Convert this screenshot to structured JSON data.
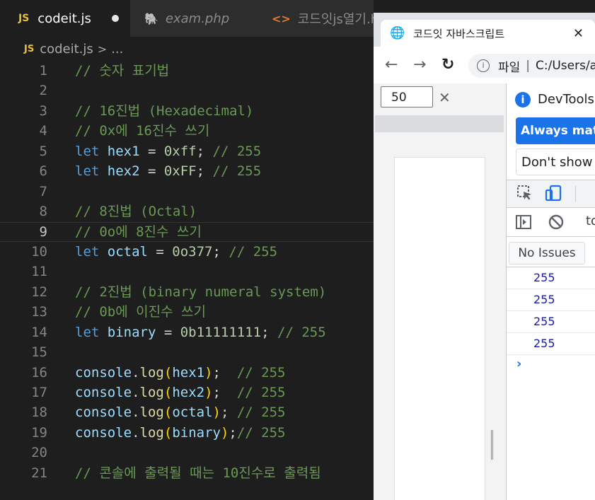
{
  "editor": {
    "tabs": [
      {
        "label": "codeit.js",
        "badge": "JS",
        "active": true,
        "dirty": true
      },
      {
        "label": "exam.php",
        "active": false
      },
      {
        "label": "코드잇js열기.h",
        "active": false
      }
    ],
    "breadcrumb": {
      "badge": "JS",
      "file": "codeit.js",
      "separator": ">",
      "more": "..."
    },
    "current_line": 9,
    "lines": [
      {
        "n": "1",
        "parts": [
          [
            "cm",
            "// 숫자 표기법"
          ]
        ]
      },
      {
        "n": "2",
        "parts": []
      },
      {
        "n": "3",
        "parts": [
          [
            "cm",
            "// 16진법 (Hexadecimal)"
          ]
        ]
      },
      {
        "n": "4",
        "parts": [
          [
            "cm",
            "// 0x에 16진수 쓰기"
          ]
        ]
      },
      {
        "n": "5",
        "parts": [
          [
            "kw",
            "let "
          ],
          [
            "var",
            "hex1"
          ],
          [
            "op",
            " = "
          ],
          [
            "num",
            "0xff"
          ],
          [
            "op",
            "; "
          ],
          [
            "cm",
            "// 255"
          ]
        ]
      },
      {
        "n": "6",
        "parts": [
          [
            "kw",
            "let "
          ],
          [
            "var",
            "hex2"
          ],
          [
            "op",
            " = "
          ],
          [
            "num",
            "0xFF"
          ],
          [
            "op",
            "; "
          ],
          [
            "cm",
            "// 255"
          ]
        ]
      },
      {
        "n": "7",
        "parts": []
      },
      {
        "n": "8",
        "parts": [
          [
            "cm",
            "// 8진법 (Octal)"
          ]
        ]
      },
      {
        "n": "9",
        "parts": [
          [
            "cm",
            "// 0o에 8진수 쓰기"
          ]
        ]
      },
      {
        "n": "10",
        "parts": [
          [
            "kw",
            "let "
          ],
          [
            "var",
            "octal"
          ],
          [
            "op",
            " = "
          ],
          [
            "num",
            "0o377"
          ],
          [
            "op",
            "; "
          ],
          [
            "cm",
            "// 255"
          ]
        ]
      },
      {
        "n": "11",
        "parts": []
      },
      {
        "n": "12",
        "parts": [
          [
            "cm",
            "// 2진법 (binary numeral system)"
          ]
        ]
      },
      {
        "n": "13",
        "parts": [
          [
            "cm",
            "// 0b에 이진수 쓰기"
          ]
        ]
      },
      {
        "n": "14",
        "parts": [
          [
            "kw",
            "let "
          ],
          [
            "var",
            "binary"
          ],
          [
            "op",
            " = "
          ],
          [
            "num",
            "0b11111111"
          ],
          [
            "op",
            "; "
          ],
          [
            "cm",
            "// 255"
          ]
        ]
      },
      {
        "n": "15",
        "parts": []
      },
      {
        "n": "16",
        "parts": [
          [
            "var",
            "console"
          ],
          [
            "op",
            "."
          ],
          [
            "fn",
            "log"
          ],
          [
            "br",
            "("
          ],
          [
            "var",
            "hex1"
          ],
          [
            "br",
            ")"
          ],
          [
            "op",
            ";  "
          ],
          [
            "cm",
            "// 255"
          ]
        ]
      },
      {
        "n": "17",
        "parts": [
          [
            "var",
            "console"
          ],
          [
            "op",
            "."
          ],
          [
            "fn",
            "log"
          ],
          [
            "br",
            "("
          ],
          [
            "var",
            "hex2"
          ],
          [
            "br",
            ")"
          ],
          [
            "op",
            ";  "
          ],
          [
            "cm",
            "// 255"
          ]
        ]
      },
      {
        "n": "18",
        "parts": [
          [
            "var",
            "console"
          ],
          [
            "op",
            "."
          ],
          [
            "fn",
            "log"
          ],
          [
            "br",
            "("
          ],
          [
            "var",
            "octal"
          ],
          [
            "br",
            ")"
          ],
          [
            "op",
            "; "
          ],
          [
            "cm",
            "// 255"
          ]
        ]
      },
      {
        "n": "19",
        "parts": [
          [
            "var",
            "console"
          ],
          [
            "op",
            "."
          ],
          [
            "fn",
            "log"
          ],
          [
            "br",
            "("
          ],
          [
            "var",
            "binary"
          ],
          [
            "br",
            ")"
          ],
          [
            "op",
            ";"
          ],
          [
            "cm",
            "// 255"
          ]
        ]
      },
      {
        "n": "20",
        "parts": []
      },
      {
        "n": "21",
        "parts": [
          [
            "cm",
            "// 콘솔에 출력될 때는 10진수로 출력됨"
          ]
        ]
      }
    ]
  },
  "browser": {
    "tab_title": "코드잇 자바스크립트",
    "tab_close": "✕",
    "omnibox_scheme": "파일",
    "omnibox_separator": "|",
    "omnibox_path": "C:/Users/a",
    "nav": {
      "back": "←",
      "forward": "→",
      "reload": "↻"
    },
    "device_toolbar": {
      "zoom_value": "50",
      "clear": "✕"
    },
    "devtools": {
      "info_text": "DevTools i",
      "always_button": "Always matc",
      "dont_show_button": "Don't show a",
      "console_context": "to",
      "issues_button": "No Issues",
      "logs": [
        "255",
        "255",
        "255",
        "255"
      ],
      "prompt": "›"
    }
  },
  "icons": {
    "globe": "globe-icon",
    "php": "php-elephant-icon",
    "html": "html-brackets-icon",
    "inspect": "inspect-element-icon",
    "device": "device-toggle-icon",
    "sidebar": "show-sidebar-icon",
    "clear": "clear-console-icon",
    "info": "info-icon"
  },
  "colors": {
    "comment": "#6a9955",
    "keyword": "#569cd6",
    "variable": "#9cdcfe",
    "number": "#b5cea8",
    "function": "#dcdcaa",
    "bracket": "#ffd700",
    "devtools_accent": "#1a73e8",
    "log_value": "#1a1aa6"
  }
}
